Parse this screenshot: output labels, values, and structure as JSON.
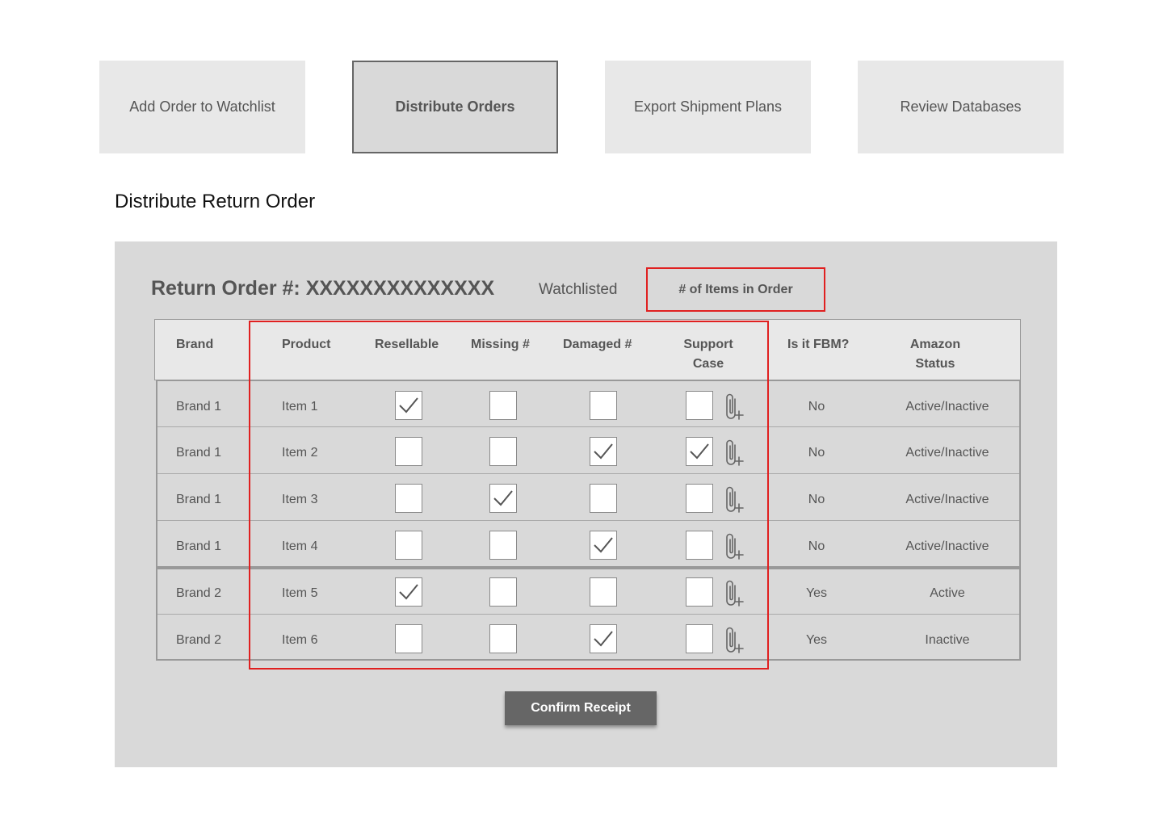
{
  "nav": [
    {
      "label": "Add Order to Watchlist",
      "active": false
    },
    {
      "label": "Distribute Orders",
      "active": true
    },
    {
      "label": "Export Shipment Plans",
      "active": false
    },
    {
      "label": "Review Databases",
      "active": false
    }
  ],
  "page_title": "Distribute Return Order",
  "order": {
    "number_label": "Return Order #: XXXXXXXXXXXXXX",
    "watchlisted": "Watchlisted",
    "items_count": "# of Items in Order"
  },
  "table": {
    "headers": {
      "brand": "Brand",
      "product": "Product",
      "resellable": "Resellable",
      "missing": "Missing #",
      "damaged": "Damaged #",
      "support_line1": "Support",
      "support_line2": "Case",
      "fbm": "Is it FBM?",
      "amazon_line1": "Amazon",
      "amazon_line2": "Status"
    },
    "rows": [
      {
        "brand": "Brand 1",
        "product": "Item 1",
        "resellable": true,
        "missing": false,
        "damaged": false,
        "support": false,
        "fbm": "No",
        "status": "Active/Inactive"
      },
      {
        "brand": "Brand 1",
        "product": "Item 2",
        "resellable": false,
        "missing": false,
        "damaged": true,
        "support": true,
        "fbm": "No",
        "status": "Active/Inactive"
      },
      {
        "brand": "Brand 1",
        "product": "Item 3",
        "resellable": false,
        "missing": true,
        "damaged": false,
        "support": false,
        "fbm": "No",
        "status": "Active/Inactive"
      },
      {
        "brand": "Brand 1",
        "product": "Item 4",
        "resellable": false,
        "missing": false,
        "damaged": true,
        "support": false,
        "fbm": "No",
        "status": "Active/Inactive"
      },
      {
        "brand": "Brand 2",
        "product": "Item 5",
        "resellable": true,
        "missing": false,
        "damaged": false,
        "support": false,
        "fbm": "Yes",
        "status": "Active"
      },
      {
        "brand": "Brand 2",
        "product": "Item 6",
        "resellable": false,
        "missing": false,
        "damaged": true,
        "support": false,
        "fbm": "Yes",
        "status": "Inactive"
      }
    ]
  },
  "confirm_label": "Confirm Receipt",
  "colors": {
    "highlight": "#e02020",
    "panel": "#d9d9d9",
    "button": "#666666"
  },
  "icons": {
    "check": "check-icon",
    "attach": "paperclip-plus-icon"
  }
}
